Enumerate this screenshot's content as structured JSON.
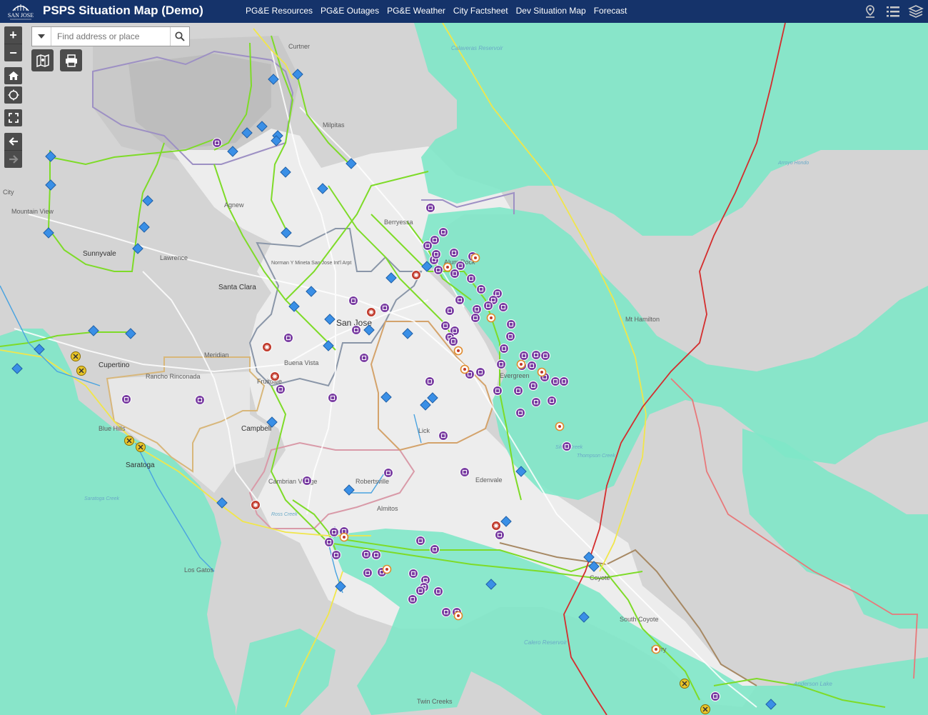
{
  "header": {
    "logo_text": "SAN JOSE",
    "title": "PSPS Situation Map (Demo)",
    "nav": [
      "PG&E Resources",
      "PG&E Outages",
      "PG&E Weather",
      "City Factsheet",
      "Dev Situation Map",
      "Forecast"
    ],
    "icons": [
      "location-pin-icon",
      "legend-list-icon",
      "layers-icon"
    ]
  },
  "search": {
    "placeholder": "Find address or place",
    "value": ""
  },
  "controls": {
    "zoom": [
      "+",
      "−"
    ],
    "nav": [
      "home-icon",
      "locate-icon",
      "fullscreen-icon",
      "back-arrow-icon",
      "forward-arrow-icon"
    ],
    "tools": [
      "basemap-gallery-icon",
      "print-icon"
    ]
  },
  "map_labels": {
    "places": [
      "Curtner",
      "Milpitas",
      "Agnew",
      "Berryessa",
      "Sunnyvale",
      "Lawrence",
      "Mountain View",
      "Santa Clara",
      "San Jose",
      "Norman Y Mineta San Jose Int'l Arpt",
      "Meridian",
      "Buena Vista",
      "Cupertino",
      "Rancho Rinconada",
      "Fruitdale",
      "Campbell",
      "Blue Hills",
      "Saratoga",
      "Cambrian Village",
      "Robertsville",
      "Almitos",
      "Los Gatos",
      "Lick",
      "Edenvale",
      "Evergreen",
      "Alum Rock",
      "Mt Hamilton",
      "Coyote",
      "South Coyote",
      "Perry",
      "Twin Creeks",
      "City"
    ],
    "water": [
      "Calaveras Reservoir",
      "Calero Reservoir",
      "Anderson Lake"
    ],
    "creeks": [
      "Ross Creek",
      "Thompson Creek",
      "Silver Creek",
      "Saratoga Creek",
      "Arroyo Hondo"
    ]
  },
  "colors": {
    "header": "#15336a",
    "psps_zone": "#7fe7c8",
    "city_area": "#ededed",
    "transmission_line": "#7edb28",
    "yellow_line": "#f1e64a",
    "red_line": "#d42d2d",
    "facility_marker": "#7b3fa3",
    "substation_marker": "#3a8fe6"
  }
}
